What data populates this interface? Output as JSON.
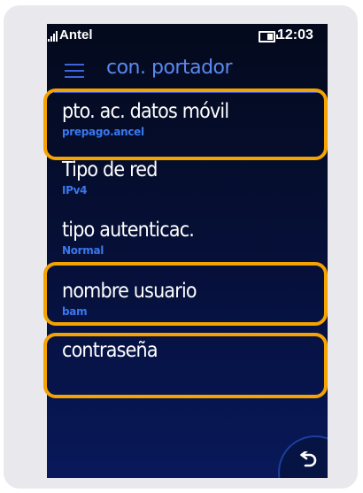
{
  "status_bar": {
    "carrier": "Antel",
    "time": "12:03"
  },
  "header": {
    "title": "con. portador"
  },
  "settings": [
    {
      "label": "pto. ac. datos móvil",
      "value": "prepago.ancel",
      "highlighted": true
    },
    {
      "label": "Tipo de red",
      "value": "IPv4",
      "highlighted": false
    },
    {
      "label": "tipo autenticac.",
      "value": "Normal",
      "highlighted": false
    },
    {
      "label": "nombre usuario",
      "value": "bam",
      "highlighted": true
    },
    {
      "label": "contraseña",
      "value": "",
      "highlighted": true
    }
  ],
  "colors": {
    "accent": "#5b88f0",
    "value_text": "#3a78ee",
    "highlight": "#f5a300"
  },
  "icons": {
    "menu": "hamburger-menu-icon",
    "back": "back-arrow-icon",
    "battery": "battery-icon",
    "signal": "signal-icon"
  }
}
